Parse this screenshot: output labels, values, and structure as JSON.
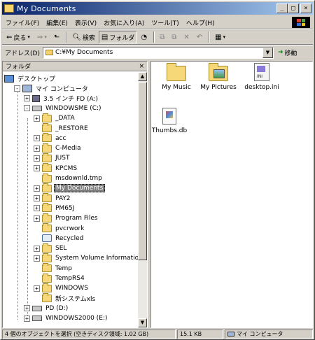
{
  "window": {
    "title": "My Documents",
    "buttons": {
      "minimize": "_",
      "maximize": "□",
      "close": "×"
    }
  },
  "menu": [
    "ファイル(F)",
    "編集(E)",
    "表示(V)",
    "お気に入り(A)",
    "ツール(T)",
    "ヘルプ(H)"
  ],
  "toolbar": {
    "back": "戻る",
    "search": "検索",
    "folders": "フォルダ"
  },
  "address": {
    "label": "アドレス(D)",
    "value": "C:¥My Documents",
    "go": "移動"
  },
  "folder_pane": {
    "title": "フォルダ",
    "close": "×",
    "tree": [
      {
        "label": "デスクトップ",
        "icon": "desktop-icon"
      },
      {
        "label": "マイ コンピュータ",
        "icon": "computer-icon",
        "expander": "-"
      },
      {
        "label": "3.5 インチ FD (A:)",
        "icon": "floppy-icon",
        "expander": "+"
      },
      {
        "label": "WINDOWSME (C:)",
        "icon": "drive-icon",
        "expander": "-"
      },
      {
        "label": "_DATA",
        "icon": "folder-icon",
        "expander": "+"
      },
      {
        "label": "_RESTORE",
        "icon": "folder-icon",
        "expander": ""
      },
      {
        "label": "acc",
        "icon": "folder-icon",
        "expander": "+"
      },
      {
        "label": "C-Media",
        "icon": "folder-icon",
        "expander": "+"
      },
      {
        "label": "JUST",
        "icon": "folder-icon",
        "expander": "+"
      },
      {
        "label": "KPCMS",
        "icon": "folder-icon",
        "expander": "+"
      },
      {
        "label": "msdownld.tmp",
        "icon": "folder-icon",
        "expander": ""
      },
      {
        "label": "My Documents",
        "icon": "folder-icon",
        "expander": "+",
        "selected": true
      },
      {
        "label": "PAY2",
        "icon": "folder-icon",
        "expander": "+"
      },
      {
        "label": "PM65J",
        "icon": "folder-icon",
        "expander": "+"
      },
      {
        "label": "Program Files",
        "icon": "folder-icon",
        "expander": "+"
      },
      {
        "label": "pvcrwork",
        "icon": "folder-icon",
        "expander": ""
      },
      {
        "label": "Recycled",
        "icon": "recycle-bin-icon",
        "expander": ""
      },
      {
        "label": "SEL",
        "icon": "folder-icon",
        "expander": "+"
      },
      {
        "label": "System Volume Information",
        "icon": "folder-icon",
        "expander": "+"
      },
      {
        "label": "Temp",
        "icon": "folder-icon",
        "expander": ""
      },
      {
        "label": "TempRS4",
        "icon": "folder-icon",
        "expander": ""
      },
      {
        "label": "WINDOWS",
        "icon": "folder-icon",
        "expander": "+"
      },
      {
        "label": "新システムxls",
        "icon": "folder-icon",
        "expander": ""
      },
      {
        "label": "PD (D:)",
        "icon": "drive-icon",
        "expander": "+"
      },
      {
        "label": "WINDOWS2000 (E:)",
        "icon": "drive-icon",
        "expander": "+"
      }
    ]
  },
  "files": [
    {
      "name": "My Music",
      "icon": "folder-icon"
    },
    {
      "name": "My Pictures",
      "icon": "pictures-folder-icon"
    },
    {
      "name": "desktop.ini",
      "icon": "ini-file-icon"
    },
    {
      "name": "Thumbs.db",
      "icon": "db-file-icon"
    }
  ],
  "status": {
    "objects": "4 個のオブジェクトを選択 (空きディスク領域: 1.02 GB)",
    "size": "15.1 KB",
    "location": "マイ コンピュータ"
  }
}
